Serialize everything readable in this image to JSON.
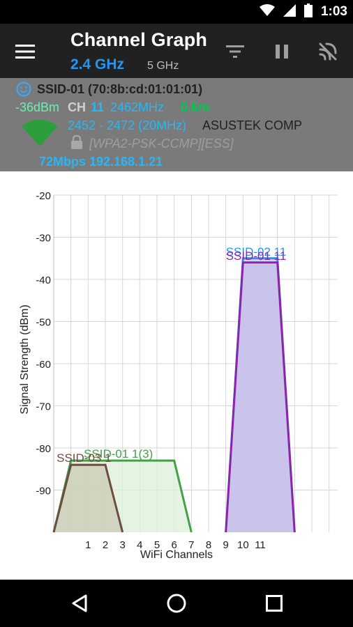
{
  "status_bar": {
    "time": "1:03"
  },
  "app_bar": {
    "title": "Channel Graph",
    "band_selected": "2.4 GHz",
    "band_other": "5 GHz"
  },
  "access_point": {
    "ssid_line": "SSID-01 (70:8b:cd:01:01:01)",
    "signal": "-36dBm",
    "channel_label": "CH",
    "channel": "11",
    "frequency": "2462MHz",
    "distance": "0.6m",
    "frequency_range": "2452 - 2472 (20MHz)",
    "vendor": "ASUSTEK COMP",
    "security": "[WPA2-PSK-CCMP][ESS]",
    "link": "72Mbps 192.168.1.21"
  },
  "chart_data": {
    "type": "area",
    "ylabel": "Signal Strength (dBm)",
    "xlabel": "WiFi Channels",
    "ylim": [
      -100,
      -20
    ],
    "xlim": [
      -1,
      15.5
    ],
    "yticks": [
      "-20",
      "-30",
      "-40",
      "-50",
      "-60",
      "-70",
      "-80",
      "-90"
    ],
    "xticks": [
      "1",
      "2",
      "3",
      "4",
      "5",
      "6",
      "7",
      "8",
      "9",
      "10",
      "11"
    ],
    "grid": true,
    "series": [
      {
        "name": "SSID-01 1(3)",
        "color": "#43a047",
        "fill": "#dcefd8",
        "points": [
          [
            -1,
            -100
          ],
          [
            0,
            -83
          ],
          [
            6,
            -83
          ],
          [
            7,
            -100
          ]
        ]
      },
      {
        "name": "SSID-03 1",
        "color": "#6d4c41",
        "fill": "#c9cbb4",
        "points": [
          [
            -1,
            -100
          ],
          [
            0,
            -84
          ],
          [
            2,
            -84
          ],
          [
            3,
            -100
          ]
        ]
      },
      {
        "name": "SSID-02 11",
        "color": "#2196f3",
        "fill": "#c8c8ec",
        "points": [
          [
            9,
            -100
          ],
          [
            10,
            -35
          ],
          [
            12,
            -35
          ],
          [
            13,
            -100
          ]
        ]
      },
      {
        "name": "SSID-01 11",
        "color": "#8e24aa",
        "fill": "#c5bdea",
        "points": [
          [
            9,
            -100
          ],
          [
            10,
            -36
          ],
          [
            12,
            -36
          ],
          [
            13,
            -100
          ]
        ]
      }
    ]
  }
}
